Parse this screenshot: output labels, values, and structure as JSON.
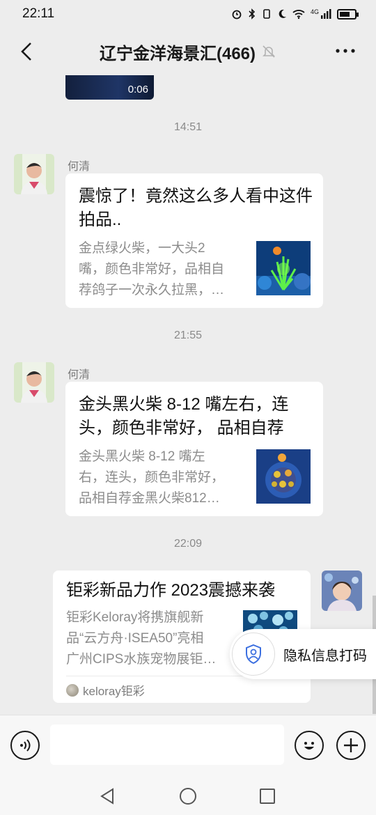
{
  "status_bar": {
    "time": "22:11",
    "network": "4G"
  },
  "header": {
    "title": "辽宁金洋海景汇(466)"
  },
  "messages": {
    "video": {
      "duration": "0:06"
    },
    "timestamps": [
      "14:51",
      "21:55",
      "22:09"
    ],
    "msg1": {
      "sender": "何清",
      "title": "震惊了！竟然这么多人看中这件拍品..",
      "desc_lines": [
        "金点绿火柴，一大头2",
        "嘴，颜色非常好，品相自",
        "荐鸽子一次永久拉黑，…"
      ]
    },
    "msg2": {
      "sender": "何清",
      "title_lines": [
        "金头黑火柴 8-12 嘴左右，连",
        "头，颜色非常好， 品相自荐"
      ],
      "desc_lines": [
        "金头黑火柴 8-12 嘴左",
        "右，连头，颜色非常好，",
        "品相自荐金黑火柴812…"
      ]
    },
    "msg3": {
      "title": "钜彩新品力作 2023震撼来袭",
      "desc_lines": [
        "钜彩Keloray将携旗舰新",
        "品“云方舟·ISEA50”亮相",
        "广州CIPS水族宠物展钜…"
      ],
      "source": "keloray钜彩"
    }
  },
  "privacy_button": {
    "label": "隐私信息打码"
  },
  "colors": {
    "background": "#ededed",
    "card": "#ffffff",
    "muted_text": "#8c8c8c"
  }
}
